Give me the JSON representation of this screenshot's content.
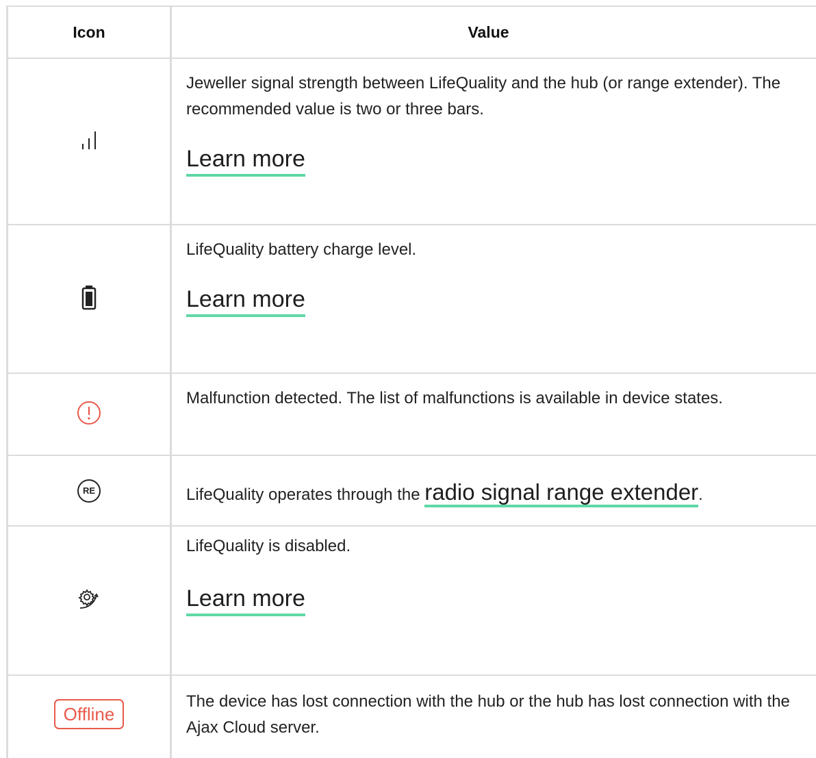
{
  "header": {
    "icon": "Icon",
    "value": "Value"
  },
  "rows": [
    {
      "icon": "signal-strength-icon",
      "text": "Jeweller signal strength between LifeQuality and the hub (or range extender). The recommended value is two or three bars.",
      "link": "Learn more"
    },
    {
      "icon": "battery-icon",
      "text": "LifeQuality battery charge level.",
      "link": "Learn more"
    },
    {
      "icon": "malfunction-icon",
      "text": "Malfunction detected. The list of malfunctions is available in device states."
    },
    {
      "icon": "range-extender-icon",
      "icon_text": "RE",
      "text_before": "LifeQuality operates through the ",
      "link": "radio signal range extender",
      "text_after": "."
    },
    {
      "icon": "disabled-settings-icon",
      "text": "LifeQuality is disabled.",
      "link": "Learn more"
    },
    {
      "icon": "offline-badge",
      "badge": "Offline",
      "text": "The device has lost connection with the hub or the hub has lost connection with the Ajax Cloud server."
    }
  ],
  "colors": {
    "link_underline": "#5fd8a5",
    "alert": "#e9594b",
    "border": "#dcdcdc"
  }
}
